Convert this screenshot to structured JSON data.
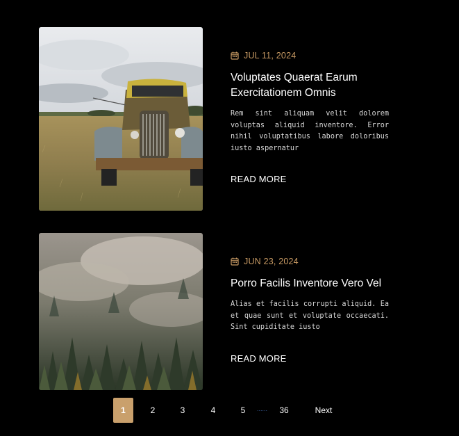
{
  "posts": [
    {
      "date": "JUL 11, 2024",
      "title": "Voluptates Quaerat Earum Exercitationem Omnis",
      "excerpt": "Rem sint aliquam velit dolorem voluptas aliquid inventore. Error nihil voluptatibus labore doloribus iusto aspernatur",
      "read_more": "READ MORE",
      "image": "old-rusty-truck-in-field"
    },
    {
      "date": "JUN 23, 2024",
      "title": "Porro Facilis Inventore Vero Vel",
      "excerpt": "Alias et facilis corrupti aliquid. Ea et quae sunt et voluptate occaecati. Sint cupiditate iusto",
      "read_more": "READ MORE",
      "image": "misty-pine-forest"
    }
  ],
  "pagination": {
    "pages": [
      "1",
      "2",
      "3",
      "4",
      "5"
    ],
    "ellipsis": "......",
    "last": "36",
    "next": "Next",
    "current": "1"
  },
  "colors": {
    "background": "#000000",
    "accent": "#c89a63",
    "active_page": "#c9a06c"
  },
  "icons": {
    "date": "calendar-icon"
  }
}
